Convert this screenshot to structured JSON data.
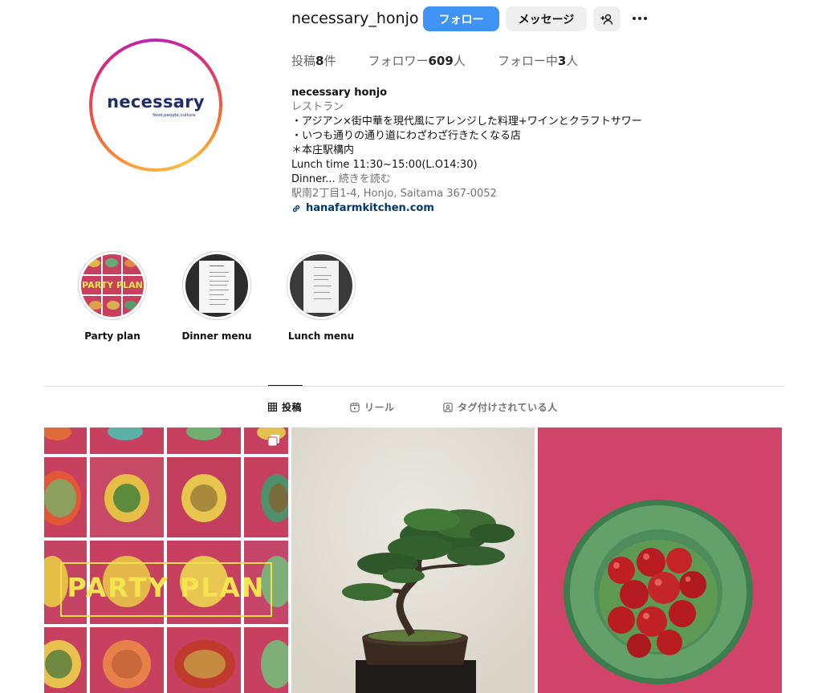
{
  "profile": {
    "username": "necessary_honjo",
    "follow_label": "フォロー",
    "message_label": "メッセージ",
    "logo_word": "necessary",
    "logo_sub": "food,people,culture"
  },
  "stats": {
    "posts_label": "投稿",
    "posts_count": "8",
    "posts_suffix": "件",
    "followers_label": "フォロワー",
    "followers_count": "609",
    "followers_suffix": "人",
    "following_label": "フォロー中",
    "following_count": "3",
    "following_suffix": "人"
  },
  "bio": {
    "name": "necessary honjo",
    "category": "レストラン",
    "line1": "・アジアン×街中華を現代風にアレンジした料理+ワインとクラフトサワー",
    "line2": "・いつも通りの通り道にわざわざ行きたくなる店",
    "line3": "＊本庄駅構内",
    "line4": "Lunch time 11:30~15:00(L.O14:30)",
    "line5_prefix": "Dinner...",
    "more_label": "続きを読む",
    "address": "駅南2丁目1-4, Honjo, Saitama 367-0052",
    "url": "hanafarmkitchen.com"
  },
  "highlights": [
    {
      "label": "Party plan",
      "cover_text": "PARTY PLAN"
    },
    {
      "label": "Dinner menu"
    },
    {
      "label": "Lunch menu"
    }
  ],
  "tabs": [
    {
      "label": "投稿",
      "icon": "grid-icon",
      "active": true
    },
    {
      "label": "リール",
      "icon": "reels-icon",
      "active": false
    },
    {
      "label": "タグ付けされている人",
      "icon": "tagged-icon",
      "active": false
    }
  ],
  "posts": [
    {
      "type": "carousel",
      "overlay_text": "PARTY PLAN"
    },
    {
      "type": "image",
      "subject": "bonsai"
    },
    {
      "type": "image",
      "subject": "tomatoes-on-green-plate"
    }
  ],
  "colors": {
    "follow_button": "#3e93f5",
    "link": "#00376b",
    "party_pink": "#c83f61",
    "party_yellow": "#f4e550"
  }
}
